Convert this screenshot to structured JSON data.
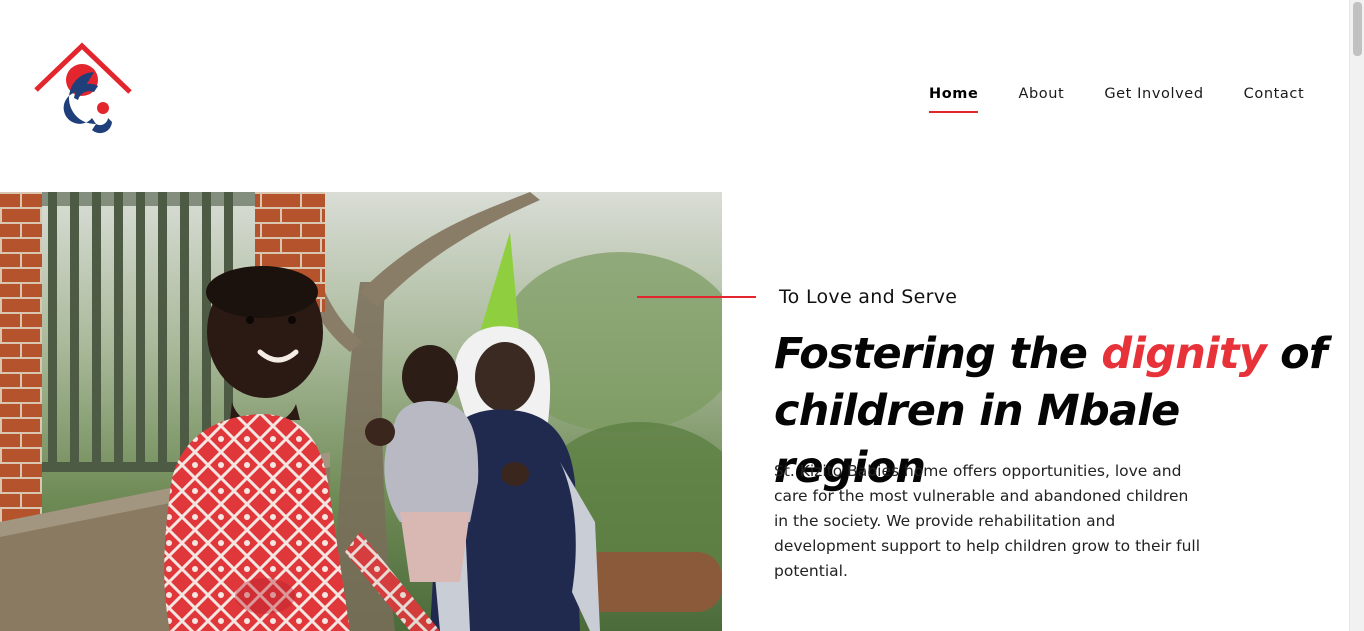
{
  "header": {
    "logo_icon": "house-family-logo-icon",
    "brand_colors": {
      "red": "#e3262d",
      "navy": "#1f3f7a"
    }
  },
  "nav": {
    "items": [
      {
        "label": "Home",
        "active": true
      },
      {
        "label": "About",
        "active": false
      },
      {
        "label": "Get Involved",
        "active": false
      },
      {
        "label": "Contact",
        "active": false
      }
    ]
  },
  "hero": {
    "image_icon": "hero-photo-children-and-caregiver",
    "tagline": "To Love and Serve",
    "headline": {
      "part1": "Fostering the ",
      "accent": "dignity",
      "part2": " of children in Mbale region"
    },
    "description": "St. Kizito Babies home offers opportunities, love and care for the most vulnerable and abandoned children in the society. We provide rehabilitation and development support to help children grow to their full potential."
  }
}
